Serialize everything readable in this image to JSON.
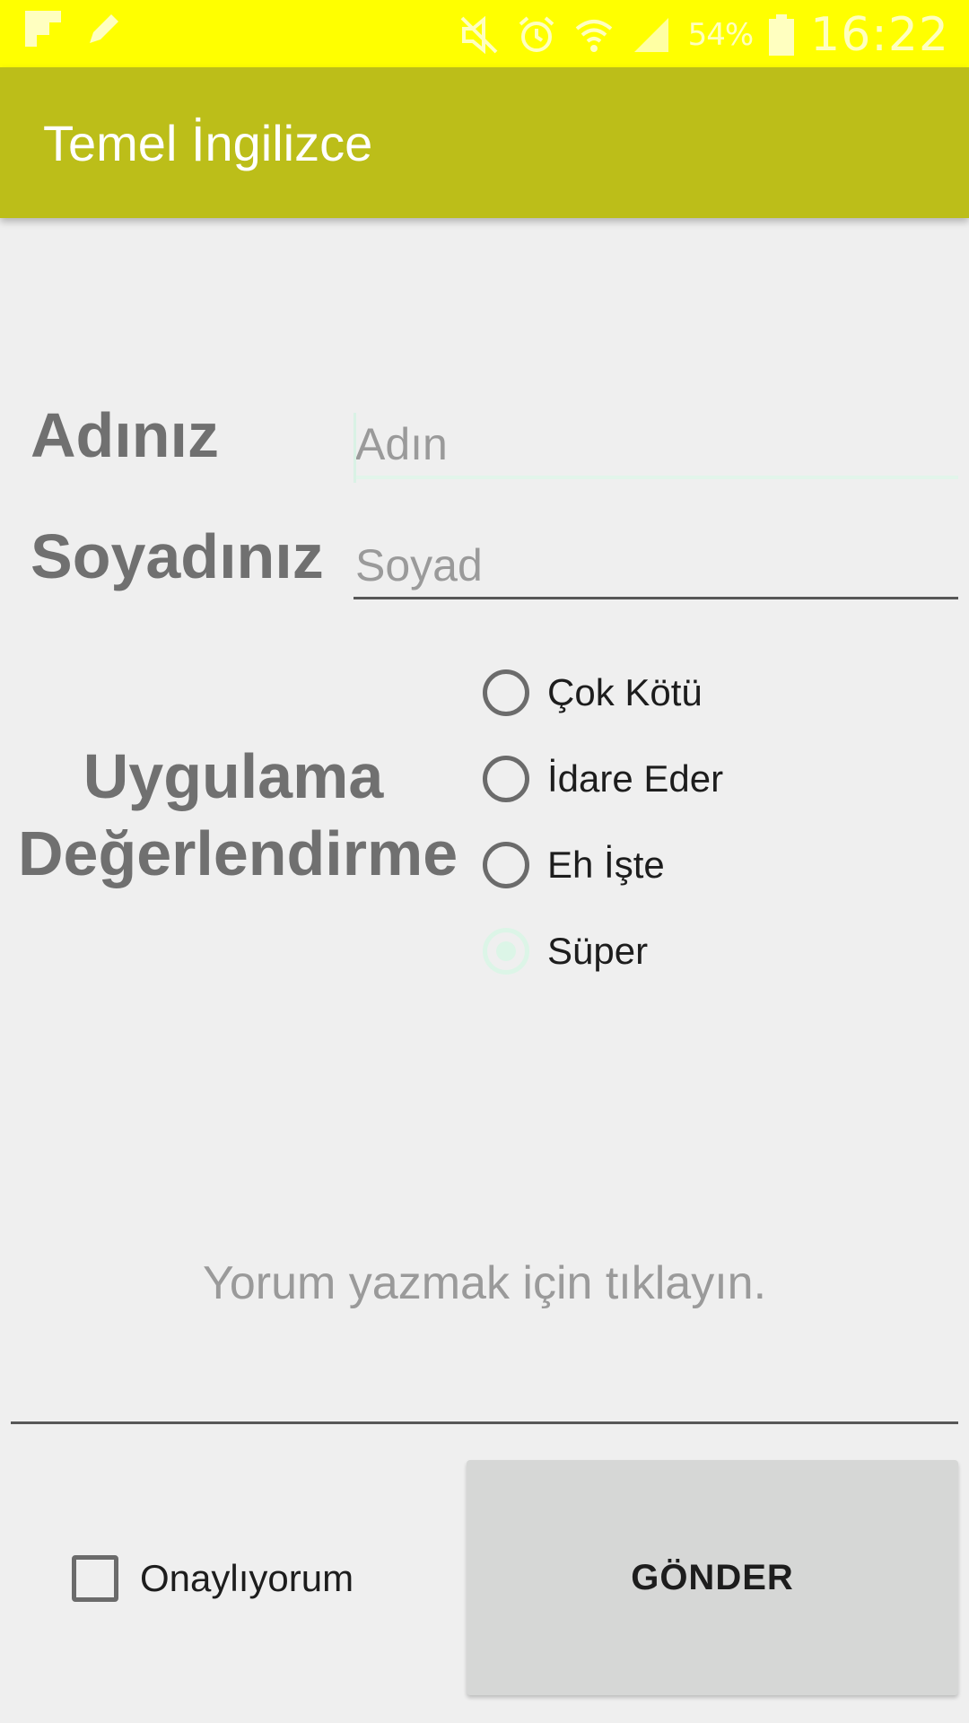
{
  "status_bar": {
    "battery_percent": "54%",
    "time": "16:22",
    "icons": [
      "flipboard-icon",
      "edit-icon",
      "mute-icon",
      "alarm-icon",
      "wifi-icon",
      "signal-icon",
      "battery-icon"
    ],
    "background_color": "#ffff00"
  },
  "app_bar": {
    "title": "Temel İngilizce",
    "background_color": "#bcbe19"
  },
  "form": {
    "name_label": "Adınız",
    "name_placeholder": "Adın",
    "name_value": "",
    "surname_label": "Soyadınız",
    "surname_placeholder": "Soyad",
    "surname_value": "",
    "rating_label": "Uygulama Değerlendirme",
    "rating_options": [
      "Çok Kötü",
      "İdare Eder",
      "Eh İşte",
      "Süper"
    ],
    "rating_selected": "Süper",
    "comment_placeholder": "Yorum yazmak için tıklayın.",
    "consent_label": "Onaylıyorum",
    "consent_checked": false,
    "submit_label": "GÖNDER"
  }
}
